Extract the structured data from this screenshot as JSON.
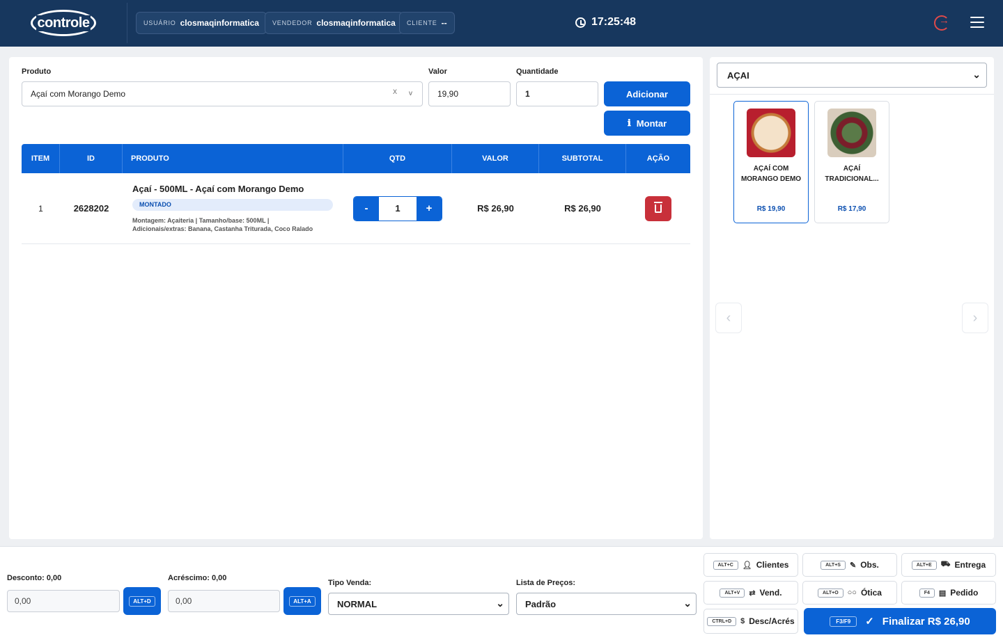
{
  "header": {
    "logo_text": "controle",
    "user_key": "USUÁRIO",
    "user_value": "closmaqinformatica",
    "seller_key": "VENDEDOR",
    "seller_value": "closmaqinformatica",
    "client_key": "CLIENTE",
    "client_value": "--",
    "time": "17:25:48"
  },
  "form": {
    "product_label": "Produto",
    "product_value": "Açaí com Morango Demo",
    "clear_symbol": "X",
    "chevron_symbol": "v",
    "value_label": "Valor",
    "value_value": "19,90",
    "quantity_label": "Quantidade",
    "quantity_value": "1",
    "add_button": "Adicionar",
    "build_button": "Montar"
  },
  "table": {
    "columns": [
      "ITEM",
      "ID",
      "PRODUTO",
      "QTD",
      "VALOR",
      "SUBTOTAL",
      "AÇÃO"
    ],
    "rows": [
      {
        "item": "1",
        "id": "2628202",
        "product": "Açaí - 500ML - Açaí com Morango Demo",
        "badge": "MONTADO",
        "desc_line1": "Montagem: Açaiteria | Tamanho/base: 500ML |",
        "desc_line2": "Adicionais/extras: Banana, Castanha Triturada, Coco Ralado",
        "minus": "-",
        "qty": "1",
        "plus": "+",
        "value": "R$ 26,90",
        "subtotal": "R$ 26,90"
      }
    ]
  },
  "side": {
    "category": "AÇAI",
    "products": [
      {
        "name": "AÇAÍ COM MORANGO DEMO",
        "price": "R$ 19,90"
      },
      {
        "name": "AÇAÍ TRADICIONAL...",
        "price": "R$ 17,90"
      }
    ],
    "prev_arrow": "‹",
    "next_arrow": "›"
  },
  "footer": {
    "discount_label": "Desconto: 0,00",
    "discount_value": "0,00",
    "discount_key": "ALT+D",
    "addition_label": "Acréscimo: 0,00",
    "addition_value": "0,00",
    "addition_key": "ALT+A",
    "sale_type_label": "Tipo Venda:",
    "sale_type_value": "NORMAL",
    "price_list_label": "Lista de Preços:",
    "price_list_value": "Padrão",
    "shortcuts": [
      {
        "key": "ALT+C",
        "label": "Clientes"
      },
      {
        "key": "ALT+S",
        "label": "Obs."
      },
      {
        "key": "ALT+E",
        "label": "Entrega"
      },
      {
        "key": "ALT+V",
        "label": "Vend."
      },
      {
        "key": "ALT+O",
        "label": "Ótica"
      },
      {
        "key": "F4",
        "label": "Pedido"
      },
      {
        "key": "CTRL+D",
        "label": "Desc/Acrés"
      }
    ],
    "finalize_key": "F3/F9",
    "finalize_label": "Finalizar R$ 26,90"
  },
  "colors": {
    "header_bg": "#17375e",
    "primary": "#0b63d6",
    "danger": "#c8303a"
  }
}
